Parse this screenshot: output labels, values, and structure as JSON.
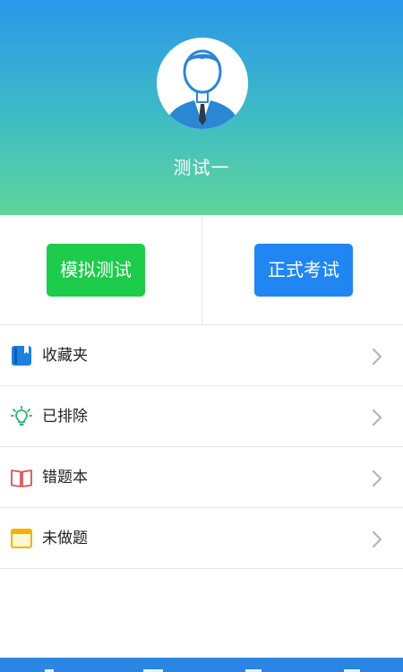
{
  "profile": {
    "name": "测试一",
    "avatar_icon": "businessman-avatar-icon"
  },
  "actions": {
    "mock_test_label": "模拟测试",
    "formal_exam_label": "正式考试"
  },
  "menu": {
    "items": [
      {
        "label": "收藏夹",
        "icon": "bookmark-icon"
      },
      {
        "label": "已排除",
        "icon": "lightbulb-icon"
      },
      {
        "label": "错题本",
        "icon": "open-book-icon"
      },
      {
        "label": "未做题",
        "icon": "window-icon"
      }
    ]
  },
  "colors": {
    "header_top": "#2b97ea",
    "header_bottom": "#5fd59a",
    "mock_button": "#1ccc4a",
    "exam_button": "#1f86f3",
    "bottom_bar": "#2a86e2"
  }
}
